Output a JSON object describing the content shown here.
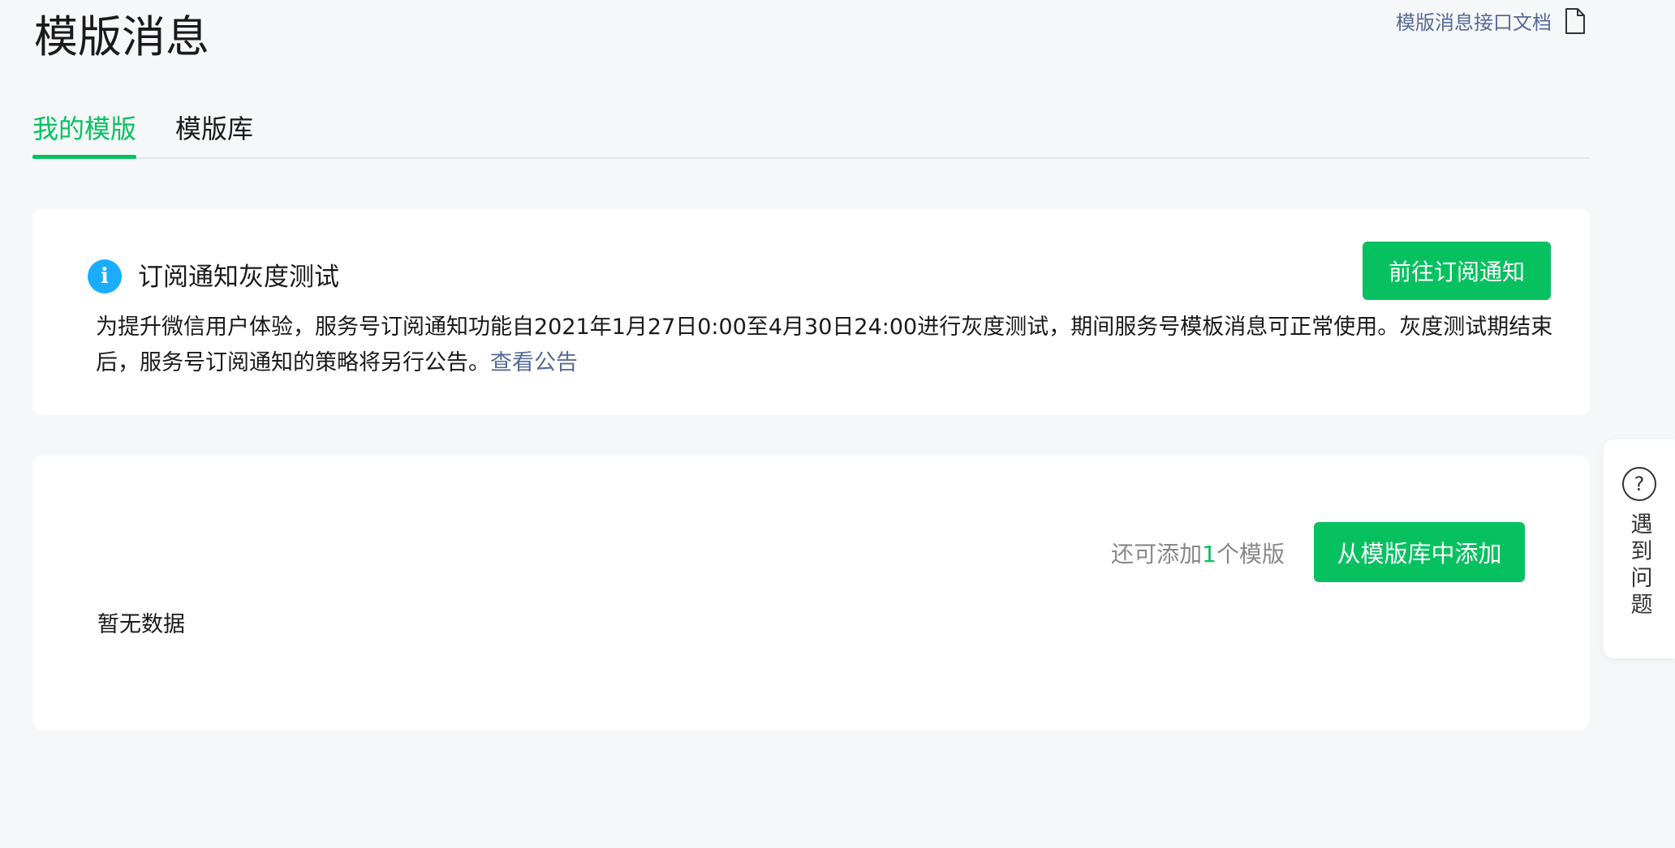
{
  "header": {
    "title": "模版消息",
    "doc_link": "模版消息接口文档"
  },
  "tabs": [
    {
      "label": "我的模版",
      "active": true
    },
    {
      "label": "模版库",
      "active": false
    }
  ],
  "notice": {
    "title": "订阅通知灰度测试",
    "body": "为提升微信用户体验，服务号订阅通知功能自2021年1月27日0:00至4月30日24:00进行灰度测试，期间服务号模板消息可正常使用。灰度测试期结束后，服务号订阅通知的策略将另行公告。",
    "link": "查看公告",
    "button": "前往订阅通知"
  },
  "templates": {
    "quota_prefix": "还可添加",
    "quota_count": "1",
    "quota_suffix": "个模版",
    "add_button": "从模版库中添加",
    "empty_text": "暂无数据"
  },
  "help": {
    "label": "遇到问题"
  },
  "colors": {
    "accent": "#07c160",
    "link": "#576b95",
    "info": "#1aadff",
    "background": "#f6f7f9"
  }
}
